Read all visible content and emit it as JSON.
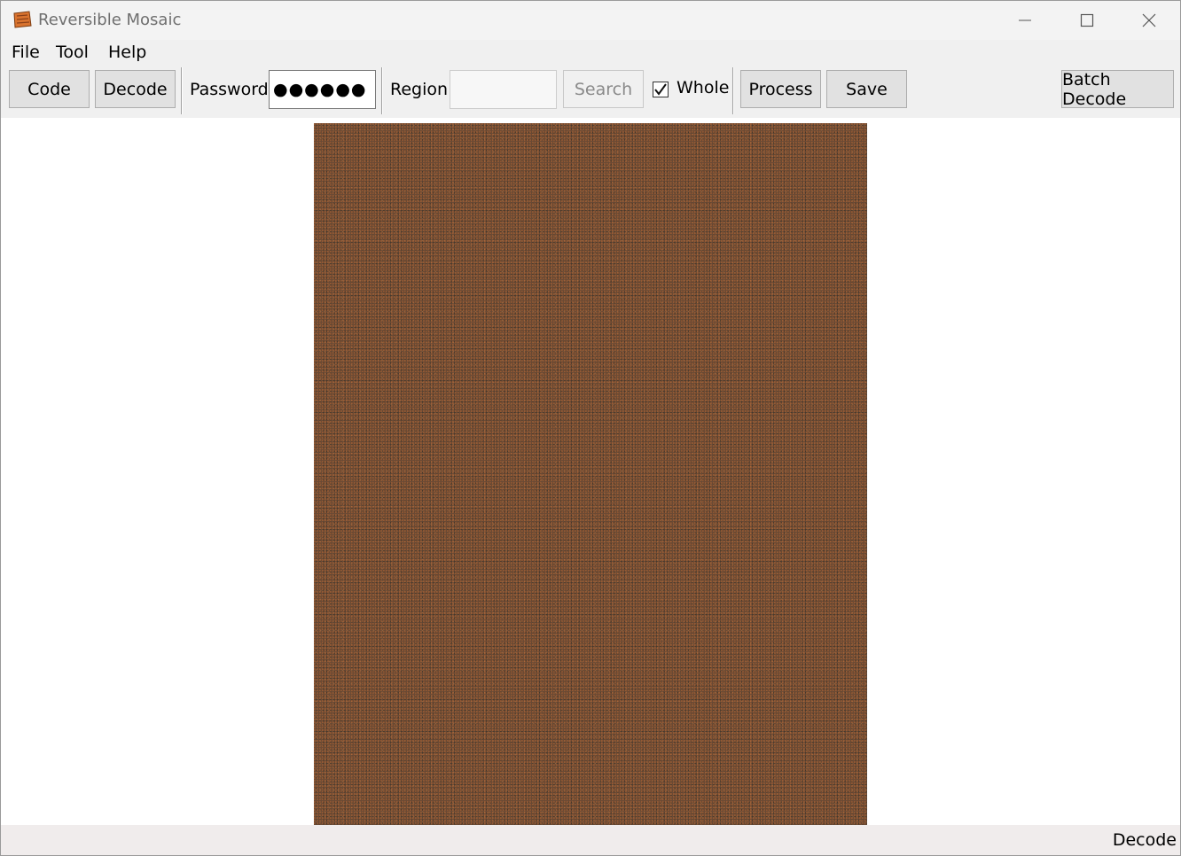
{
  "window": {
    "title": "Reversible Mosaic"
  },
  "menu": {
    "items": [
      "File",
      "Tool",
      "Help"
    ]
  },
  "toolbar": {
    "code_label": "Code",
    "decode_label": "Decode",
    "password_label": "Password",
    "password_value": "●●●●●●",
    "region_label": "Region",
    "region_value": "",
    "search_label": "Search",
    "whole_label": "Whole",
    "whole_checked": true,
    "process_label": "Process",
    "save_label": "Save",
    "batch_decode_label": "Batch Decode"
  },
  "content": {
    "image_icon": "scrambled-mosaic-image"
  },
  "status": {
    "text": "Decode"
  },
  "colors": {
    "titlebar_bg": "#f3f3f3",
    "toolbar_bg": "#f0f0f0",
    "mosaic_base": "#6b4a34",
    "button_bg": "#e1e1e1"
  }
}
